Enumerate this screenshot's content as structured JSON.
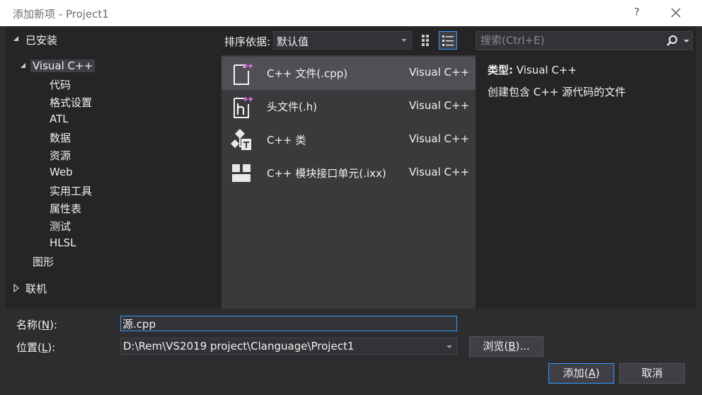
{
  "window": {
    "title": "添加新项 - Project1",
    "help": "?"
  },
  "tree": {
    "installed": "已安装",
    "visual_cpp": "Visual C++",
    "children": [
      "代码",
      "格式设置",
      "ATL",
      "数据",
      "资源",
      "Web",
      "实用工具",
      "属性表",
      "测试",
      "HLSL"
    ],
    "graphics": "图形",
    "online": "联机"
  },
  "toolbar": {
    "sort_label": "排序依据:",
    "sort_value": "默认值"
  },
  "search": {
    "placeholder": "搜索(Ctrl+E)"
  },
  "templates": [
    {
      "name": "C++ 文件(.cpp)",
      "lang": "Visual C++",
      "icon": "cpp-file-icon"
    },
    {
      "name": "头文件(.h)",
      "lang": "Visual C++",
      "icon": "header-file-icon"
    },
    {
      "name": "C++ 类",
      "lang": "Visual C++",
      "icon": "cpp-class-icon"
    },
    {
      "name": "C++ 模块接口单元(.ixx)",
      "lang": "Visual C++",
      "icon": "module-icon"
    }
  ],
  "details": {
    "type_label": "类型:",
    "type_value": "Visual C++",
    "description": "创建包含 C++ 源代码的文件"
  },
  "form": {
    "name_label_pre": "名称(",
    "name_label_acc": "N",
    "name_label_post": "):",
    "name_value": "源.cpp",
    "location_label_pre": "位置(",
    "location_label_acc": "L",
    "location_label_post": "):",
    "location_value": "D:\\Rem\\VS2019 project\\Clanguage\\Project1",
    "browse_pre": "浏览(",
    "browse_acc": "B",
    "browse_post": ")...",
    "add_pre": "添加(",
    "add_acc": "A",
    "add_post": ")",
    "cancel": "取消"
  },
  "colors": {
    "accent": "#3399ff",
    "icon_pink": "#d46ad6"
  }
}
